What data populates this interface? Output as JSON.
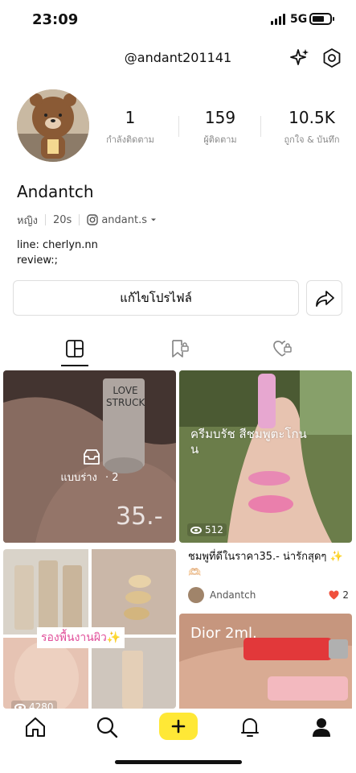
{
  "status_bar": {
    "time": "23:09",
    "network": "5G"
  },
  "header": {
    "handle": "@andant201141"
  },
  "profile": {
    "nickname": "Andantch",
    "gender": "หญิง",
    "age": "20s",
    "instagram": "andant.s",
    "bio_lines": [
      "line: cherlyn.nn",
      "review:;"
    ]
  },
  "stats": [
    {
      "value": "1",
      "label": "กำลังติดตาม"
    },
    {
      "value": "159",
      "label": "ผู้ติดตาม"
    },
    {
      "value": "10.5K",
      "label": "ถูกใจ & บันทึก"
    }
  ],
  "buttons": {
    "edit_profile": "แก้ไขโปรไฟล์"
  },
  "posts": {
    "draft": {
      "label": "แบบร่าง",
      "count": "· 2",
      "overlay_text": "35.-"
    },
    "post1": {
      "views": "512",
      "overlay_text": "ครีมบรัช สีชมพูตะโกนน"
    },
    "post2": {
      "views": "4280",
      "overlay_text": "รองพื้นงานผิว✨"
    },
    "post1_detail": {
      "title": "ชมพูที่ดีในราคา35.- น่ารักสุดๆ ✨🫶🏻",
      "author": "Andantch",
      "likes": "2"
    },
    "post3": {
      "overlay_text": "Dior 2ml."
    }
  },
  "colors": {
    "accent_yellow": "#ffe836",
    "heart_red": "#f0503c"
  }
}
